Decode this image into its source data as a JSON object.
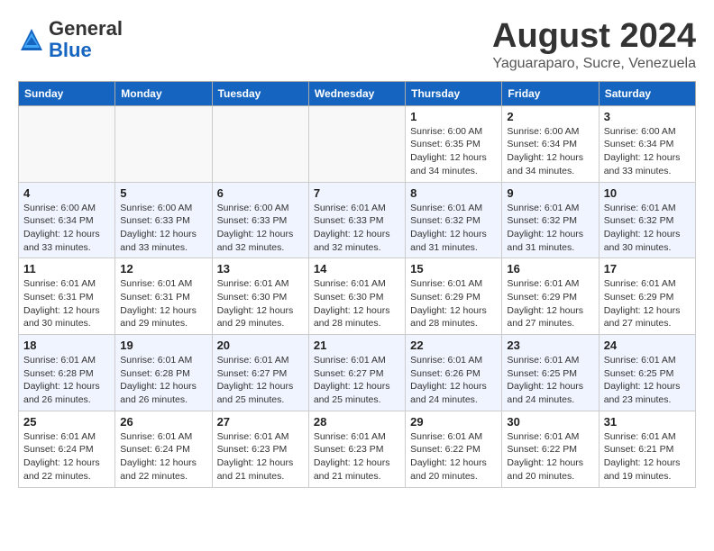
{
  "header": {
    "logo_general": "General",
    "logo_blue": "Blue",
    "month_year": "August 2024",
    "location": "Yaguaraparo, Sucre, Venezuela"
  },
  "weekdays": [
    "Sunday",
    "Monday",
    "Tuesday",
    "Wednesday",
    "Thursday",
    "Friday",
    "Saturday"
  ],
  "weeks": [
    [
      {
        "day": "",
        "info": ""
      },
      {
        "day": "",
        "info": ""
      },
      {
        "day": "",
        "info": ""
      },
      {
        "day": "",
        "info": ""
      },
      {
        "day": "1",
        "info": "Sunrise: 6:00 AM\nSunset: 6:35 PM\nDaylight: 12 hours\nand 34 minutes."
      },
      {
        "day": "2",
        "info": "Sunrise: 6:00 AM\nSunset: 6:34 PM\nDaylight: 12 hours\nand 34 minutes."
      },
      {
        "day": "3",
        "info": "Sunrise: 6:00 AM\nSunset: 6:34 PM\nDaylight: 12 hours\nand 33 minutes."
      }
    ],
    [
      {
        "day": "4",
        "info": "Sunrise: 6:00 AM\nSunset: 6:34 PM\nDaylight: 12 hours\nand 33 minutes."
      },
      {
        "day": "5",
        "info": "Sunrise: 6:00 AM\nSunset: 6:33 PM\nDaylight: 12 hours\nand 33 minutes."
      },
      {
        "day": "6",
        "info": "Sunrise: 6:00 AM\nSunset: 6:33 PM\nDaylight: 12 hours\nand 32 minutes."
      },
      {
        "day": "7",
        "info": "Sunrise: 6:01 AM\nSunset: 6:33 PM\nDaylight: 12 hours\nand 32 minutes."
      },
      {
        "day": "8",
        "info": "Sunrise: 6:01 AM\nSunset: 6:32 PM\nDaylight: 12 hours\nand 31 minutes."
      },
      {
        "day": "9",
        "info": "Sunrise: 6:01 AM\nSunset: 6:32 PM\nDaylight: 12 hours\nand 31 minutes."
      },
      {
        "day": "10",
        "info": "Sunrise: 6:01 AM\nSunset: 6:32 PM\nDaylight: 12 hours\nand 30 minutes."
      }
    ],
    [
      {
        "day": "11",
        "info": "Sunrise: 6:01 AM\nSunset: 6:31 PM\nDaylight: 12 hours\nand 30 minutes."
      },
      {
        "day": "12",
        "info": "Sunrise: 6:01 AM\nSunset: 6:31 PM\nDaylight: 12 hours\nand 29 minutes."
      },
      {
        "day": "13",
        "info": "Sunrise: 6:01 AM\nSunset: 6:30 PM\nDaylight: 12 hours\nand 29 minutes."
      },
      {
        "day": "14",
        "info": "Sunrise: 6:01 AM\nSunset: 6:30 PM\nDaylight: 12 hours\nand 28 minutes."
      },
      {
        "day": "15",
        "info": "Sunrise: 6:01 AM\nSunset: 6:29 PM\nDaylight: 12 hours\nand 28 minutes."
      },
      {
        "day": "16",
        "info": "Sunrise: 6:01 AM\nSunset: 6:29 PM\nDaylight: 12 hours\nand 27 minutes."
      },
      {
        "day": "17",
        "info": "Sunrise: 6:01 AM\nSunset: 6:29 PM\nDaylight: 12 hours\nand 27 minutes."
      }
    ],
    [
      {
        "day": "18",
        "info": "Sunrise: 6:01 AM\nSunset: 6:28 PM\nDaylight: 12 hours\nand 26 minutes."
      },
      {
        "day": "19",
        "info": "Sunrise: 6:01 AM\nSunset: 6:28 PM\nDaylight: 12 hours\nand 26 minutes."
      },
      {
        "day": "20",
        "info": "Sunrise: 6:01 AM\nSunset: 6:27 PM\nDaylight: 12 hours\nand 25 minutes."
      },
      {
        "day": "21",
        "info": "Sunrise: 6:01 AM\nSunset: 6:27 PM\nDaylight: 12 hours\nand 25 minutes."
      },
      {
        "day": "22",
        "info": "Sunrise: 6:01 AM\nSunset: 6:26 PM\nDaylight: 12 hours\nand 24 minutes."
      },
      {
        "day": "23",
        "info": "Sunrise: 6:01 AM\nSunset: 6:25 PM\nDaylight: 12 hours\nand 24 minutes."
      },
      {
        "day": "24",
        "info": "Sunrise: 6:01 AM\nSunset: 6:25 PM\nDaylight: 12 hours\nand 23 minutes."
      }
    ],
    [
      {
        "day": "25",
        "info": "Sunrise: 6:01 AM\nSunset: 6:24 PM\nDaylight: 12 hours\nand 22 minutes."
      },
      {
        "day": "26",
        "info": "Sunrise: 6:01 AM\nSunset: 6:24 PM\nDaylight: 12 hours\nand 22 minutes."
      },
      {
        "day": "27",
        "info": "Sunrise: 6:01 AM\nSunset: 6:23 PM\nDaylight: 12 hours\nand 21 minutes."
      },
      {
        "day": "28",
        "info": "Sunrise: 6:01 AM\nSunset: 6:23 PM\nDaylight: 12 hours\nand 21 minutes."
      },
      {
        "day": "29",
        "info": "Sunrise: 6:01 AM\nSunset: 6:22 PM\nDaylight: 12 hours\nand 20 minutes."
      },
      {
        "day": "30",
        "info": "Sunrise: 6:01 AM\nSunset: 6:22 PM\nDaylight: 12 hours\nand 20 minutes."
      },
      {
        "day": "31",
        "info": "Sunrise: 6:01 AM\nSunset: 6:21 PM\nDaylight: 12 hours\nand 19 minutes."
      }
    ]
  ]
}
